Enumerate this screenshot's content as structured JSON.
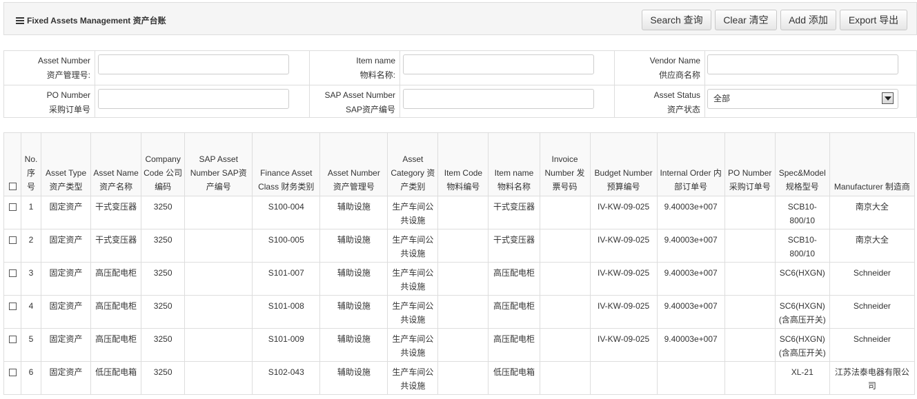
{
  "header": {
    "title": "Fixed Assets Management 资产台账",
    "buttons": {
      "search": "Search 查询",
      "clear": "Clear 清空",
      "add": "Add 添加",
      "export": "Export 导出"
    }
  },
  "form": {
    "asset_number": {
      "label_en": "Asset Number",
      "label_cn": "资产管理号:",
      "value": ""
    },
    "item_name": {
      "label_en": "Item name",
      "label_cn": "物料名称:",
      "value": ""
    },
    "vendor_name": {
      "label_en": "Vendor Name",
      "label_cn": "供应商名称",
      "value": ""
    },
    "po_number": {
      "label_en": "PO Number",
      "label_cn": "采购订单号",
      "value": ""
    },
    "sap_asset_number": {
      "label_en": "SAP Asset Number",
      "label_cn": "SAP资产编号",
      "value": ""
    },
    "asset_status": {
      "label_en": "Asset Status",
      "label_cn": "资产状态",
      "value": "全部"
    }
  },
  "table": {
    "columns": [
      "",
      "No. 序 号",
      "Asset Type 资产类型",
      "Asset Name 资产名称",
      "Company Code 公司编码",
      "SAP Asset Number SAP资产编号",
      "Finance Asset Class 财务类别",
      "Asset Number 资产管理号",
      "Asset Category 资产类别",
      "Item Code 物料编号",
      "Item name 物料名称",
      "Invoice Number 发票号码",
      "Budget Number 预算编号",
      "Internal Order 内部订单号",
      "PO Number 采购订单号",
      "Spec&Model 规格型号",
      "Manufacturer 制造商"
    ],
    "rows": [
      [
        "",
        "1",
        "固定资产",
        "干式变压器",
        "3250",
        "",
        "S100-004",
        "辅助设施",
        "生产车间公共设施",
        "",
        "干式变压器",
        "",
        "IV-KW-09-025",
        "9.40003e+007",
        "",
        "SCB10-800/10",
        "南京大全"
      ],
      [
        "",
        "2",
        "固定资产",
        "干式变压器",
        "3250",
        "",
        "S100-005",
        "辅助设施",
        "生产车间公共设施",
        "",
        "干式变压器",
        "",
        "IV-KW-09-025",
        "9.40003e+007",
        "",
        "SCB10-800/10",
        "南京大全"
      ],
      [
        "",
        "3",
        "固定资产",
        "高压配电柜",
        "3250",
        "",
        "S101-007",
        "辅助设施",
        "生产车间公共设施",
        "",
        "高压配电柜",
        "",
        "IV-KW-09-025",
        "9.40003e+007",
        "",
        "SC6(HXGN)",
        "Schneider"
      ],
      [
        "",
        "4",
        "固定资产",
        "高压配电柜",
        "3250",
        "",
        "S101-008",
        "辅助设施",
        "生产车间公共设施",
        "",
        "高压配电柜",
        "",
        "IV-KW-09-025",
        "9.40003e+007",
        "",
        "SC6(HXGN)(含高压开关)",
        "Schneider"
      ],
      [
        "",
        "5",
        "固定资产",
        "高压配电柜",
        "3250",
        "",
        "S101-009",
        "辅助设施",
        "生产车间公共设施",
        "",
        "高压配电柜",
        "",
        "IV-KW-09-025",
        "9.40003e+007",
        "",
        "SC6(HXGN)(含高压开关)",
        "Schneider"
      ],
      [
        "",
        "6",
        "固定资产",
        "低压配电箱",
        "3250",
        "",
        "S102-043",
        "辅助设施",
        "生产车间公共设施",
        "",
        "低压配电箱",
        "",
        "",
        "",
        "",
        "XL-21",
        "江苏法泰电器有限公司"
      ]
    ]
  }
}
